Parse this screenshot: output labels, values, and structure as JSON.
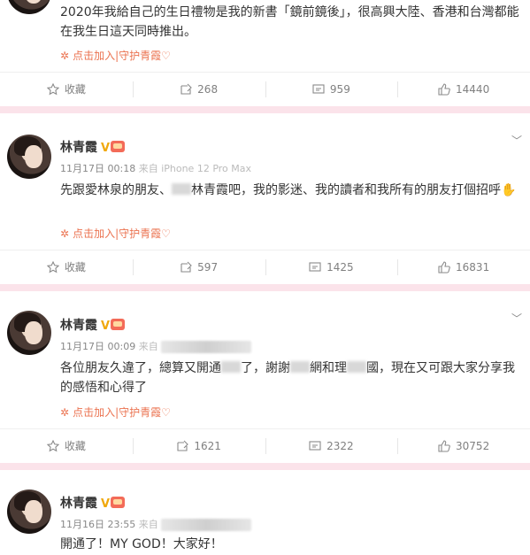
{
  "posts": [
    {
      "text": "2020年我給自己的生日禮物是我的新書「鏡前鏡後」，很高興大陸、香港和台灣都能在我生日這天同時推出。",
      "guard": "点击加入|守护青霞♡",
      "actions": {
        "collect": "收藏",
        "repost": "268",
        "comment": "959",
        "like": "14440"
      }
    },
    {
      "user": "林青霞",
      "vbadge": "V",
      "time": "11月17日 00:18",
      "from": "来自 iPhone 12 Pro Max",
      "text_a": "先跟愛林泉的朋友、",
      "text_b": "林青霞吧，我的影迷、我的讀者和我所有的朋友打個招呼",
      "guard": "点击加入|守护青霞♡",
      "actions": {
        "collect": "收藏",
        "repost": "597",
        "comment": "1425",
        "like": "16831"
      }
    },
    {
      "user": "林青霞",
      "vbadge": "V",
      "time": "11月17日 00:09",
      "from": "来自",
      "text_a": "各位朋友久違了，總算又開通",
      "text_b": "了，謝謝",
      "text_c": "網和理",
      "text_d": "國，現在又可跟大家分享我的感悟和心得了",
      "guard": "点击加入|守护青霞♡",
      "actions": {
        "collect": "收藏",
        "repost": "1621",
        "comment": "2322",
        "like": "30752"
      }
    },
    {
      "user": "林青霞",
      "vbadge": "V",
      "time": "11月16日 23:55",
      "from": "来自",
      "text": "開通了！MY GOD！大家好！"
    }
  ],
  "colors": {
    "separator": "#fbe3ea",
    "guard": "#eb7350",
    "vbadge": "#f0a80c"
  },
  "icons": {
    "collect": "star-icon",
    "repost": "repost-icon",
    "comment": "comment-icon",
    "like": "thumbs-up-icon",
    "menu": "chevron-down-icon"
  }
}
